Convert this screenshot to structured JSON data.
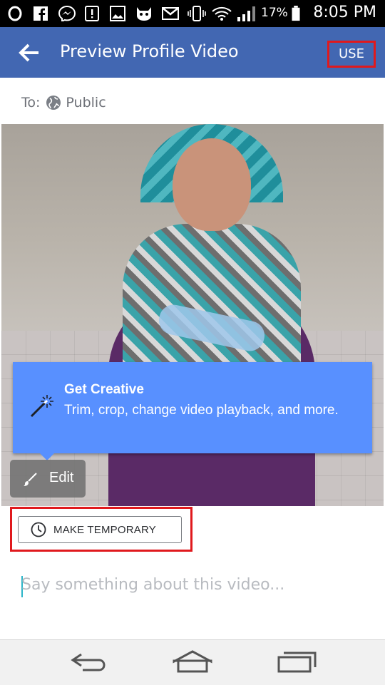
{
  "status_bar": {
    "icons": [
      "opera-icon",
      "facebook-icon",
      "messenger-icon",
      "alert-icon",
      "gallery-icon",
      "cat-icon",
      "gmail-icon",
      "vibrate-icon",
      "wifi-icon",
      "signal-icon",
      "battery-icon"
    ],
    "battery": "17%",
    "time": "8:05 PM"
  },
  "appbar": {
    "title": "Preview Profile Video",
    "use_label": "USE",
    "accent": "#4267b2"
  },
  "audience": {
    "prefix": "To:",
    "value": "Public"
  },
  "tooltip": {
    "title": "Get Creative",
    "body": "Trim, crop, change video playback, and more.",
    "color": "#5890ff"
  },
  "edit": {
    "label": "Edit"
  },
  "temporary": {
    "label": "MAKE TEMPORARY"
  },
  "composer": {
    "placeholder": "Say something about this video..."
  },
  "navbar": {
    "icons": [
      "back-nav-icon",
      "home-nav-icon",
      "recents-nav-icon"
    ]
  }
}
